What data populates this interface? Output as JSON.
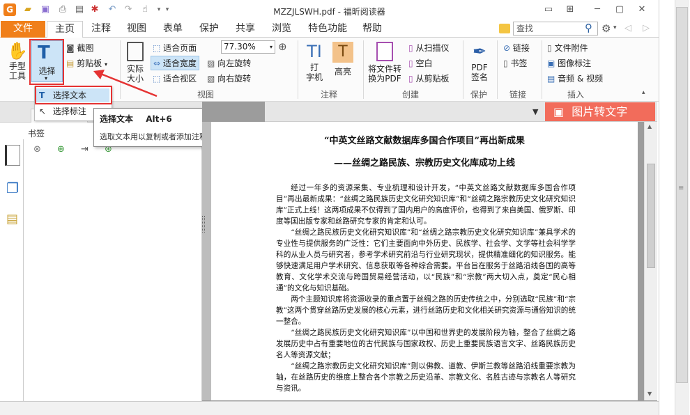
{
  "window": {
    "title": "MZZJLSWH.pdf - 福昕阅读器"
  },
  "tabs": [
    {
      "label": "文件"
    },
    {
      "label": "主页"
    },
    {
      "label": "注释"
    },
    {
      "label": "视图"
    },
    {
      "label": "表单"
    },
    {
      "label": "保护"
    },
    {
      "label": "共享"
    },
    {
      "label": "浏览"
    },
    {
      "label": "特色功能"
    },
    {
      "label": "帮助"
    }
  ],
  "search": {
    "placeholder": "查找"
  },
  "ribbon": {
    "hand": "手型\n工具",
    "select": "选择",
    "screenshot": "截图",
    "clipboard": "剪贴板",
    "actual_size": "实际\n大小",
    "fit_page": "适合页面",
    "fit_width": "适合宽度",
    "fit_view": "适合视区",
    "zoom": "77.30%",
    "rotate_left": "向左旋转",
    "rotate_right": "向右旋转",
    "typewriter": "打\n字机",
    "highlight": "高亮",
    "to_pdf": "将文件转\n换为PDF",
    "from_scan": "从扫描仪",
    "blank": "空白",
    "from_clipboard": "从剪贴板",
    "pdf_sign": "PDF\n签名",
    "link": "链接",
    "bookmark": "书签",
    "attachment": "文件附件",
    "image_mark": "图像标注",
    "audio_video": "音频 & 视频",
    "groups": {
      "view": "视图",
      "comment": "注释",
      "create": "创建",
      "protect": "保护",
      "link": "链接",
      "insert": "插入"
    }
  },
  "dropdown": {
    "select_text": "选择文本",
    "select_annotation": "选择标注"
  },
  "tooltip": {
    "title": "选择文本",
    "shortcut": "Alt+6",
    "desc": "选取文本用以复制或者添加注释"
  },
  "panel": {
    "bookmarks_label": "书签",
    "panel_tab": "书签"
  },
  "promo": {
    "label": "图片转文字"
  },
  "doc": {
    "title": "“中英文丝路文献数据库多国合作项目”再出新成果",
    "subtitle": "——丝绸之路民族、宗教历史文化库成功上线",
    "paragraphs": [
      "经过一年多的资源采集、专业梳理和设计开发，“中英文丝路文献数据库多国合作项目”再出最新成果：“丝绸之路民族历史文化研究知识库”和“丝绸之路宗教历史文化研究知识库”正式上线！这两项成果不仅得到了国内用户的高度评价，也得到了来自美国、俄罗斯、印度等国出版专家和丝路研究专家的肯定和认可。",
      "“丝绸之路民族历史文化研究知识库”和“丝绸之路宗教历史文化研究知识库”兼具学术的专业性与提供服务的广泛性：它们主要面向中外历史、民族学、社会学、文学等社会科学学科的从业人员与研究者，参考学术研究前沿与行业研究现状，提供精准细化的知识服务。能够快速满足用户学术研究、信息获取等各种综合需要。平台旨在服务于丝路沿线各国的高等教育、文化学术交流与跨国贸易经营活动，以“民族”和“宗教”两大切入点，奠定“民心相通”的文化与知识基础。",
      "两个主题知识库将资源收录的重点置于丝绸之路的历史传统之中，分别选取“民族”和“宗教”这两个贯穿丝路历史发展的核心元素，进行丝路历史和文化相关研究资源与通俗知识的统一整合。",
      "“丝绸之路民族历史文化研究知识库”以中国和世界史的发展阶段为轴，整合了丝绸之路发展历史中占有重要地位的古代民族与国家政权、历史上重要民族语言文字、丝路民族历史名人等资源文献；",
      "“丝绸之路宗教历史文化研究知识库”则以佛教、道教、伊斯兰教等丝路沿线重要宗教为轴，在丝路历史的维度上整合各个宗教之历史沿革、宗教文化、名胜古迹与宗教名人等研究与资讯。"
    ]
  },
  "colors": {
    "accent": "#f07f1a",
    "highlight_box": "#e53333",
    "selected_bg": "#cce4f7",
    "promo_bg": "#f26c5b"
  }
}
